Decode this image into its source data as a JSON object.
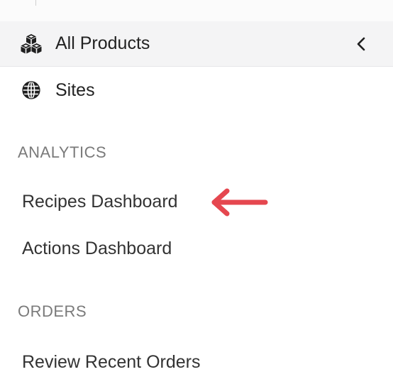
{
  "nav": {
    "items": [
      {
        "label": "All Products",
        "icon": "cubes-icon",
        "active": true
      },
      {
        "label": "Sites",
        "icon": "globe-icon",
        "active": false
      }
    ],
    "collapse_icon": "chevron-left-icon"
  },
  "sections": [
    {
      "header": "ANALYTICS",
      "links": [
        "Recipes Dashboard",
        "Actions Dashboard"
      ]
    },
    {
      "header": "ORDERS",
      "links": [
        "Review Recent Orders"
      ]
    }
  ],
  "annotation": {
    "icon": "arrow-left-icon",
    "color": "#e5474f",
    "target": "Recipes Dashboard"
  },
  "colors": {
    "active_bg": "#f4f4f5",
    "section_header": "#7a7a7a",
    "text": "#333333"
  }
}
